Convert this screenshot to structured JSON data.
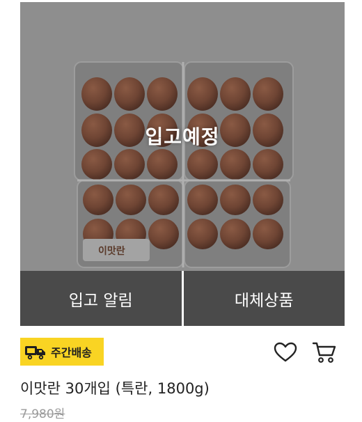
{
  "product": {
    "status_label": "입고예정",
    "name": "이맛란 30개입 (특란, 1800g)",
    "original_price": "7,980원",
    "package_brand": "이맛란"
  },
  "actions": {
    "notify_label": "입고 알림",
    "substitute_label": "대체상품"
  },
  "badge": {
    "label": "주간배송",
    "color": "#f9d423"
  },
  "icons": {
    "wishlist": "heart-icon",
    "cart": "cart-icon",
    "delivery": "truck-icon"
  },
  "colors": {
    "button_bg": "#4a4a4a",
    "badge_bg": "#f9d423",
    "strike_price": "#9a9a9a"
  }
}
